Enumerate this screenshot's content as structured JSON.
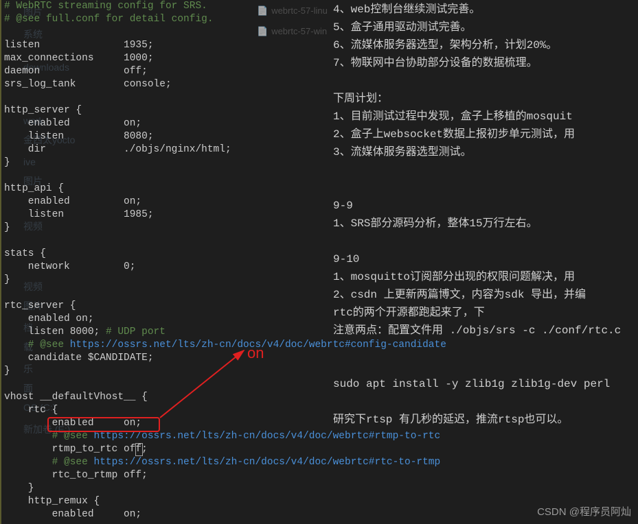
{
  "code": {
    "l1": "# WebRTC streaming config for SRS.",
    "l2": "# @see full.conf for detail config.",
    "l3": "",
    "l4": "listen              1935;",
    "l5": "max_connections     1000;",
    "l6": "daemon              off;",
    "l7": "srs_log_tank        console;",
    "l8": "",
    "l9": "http_server {",
    "l10": "    enabled         on;",
    "l11": "    listen          8080;",
    "l12": "    dir             ./objs/nginx/html;",
    "l13": "}",
    "l14": "",
    "l15": "http_api {",
    "l16": "    enabled         on;",
    "l17": "    listen          1985;",
    "l18": "}",
    "l19": "",
    "l20": "stats {",
    "l21": "    network         0;",
    "l22": "}",
    "l23": "",
    "l24": "rtc_server {",
    "l25": "    enabled on;",
    "l26a": "    listen 8000; ",
    "l26b": "# UDP port",
    "l27a": "    # @see ",
    "l27b": "https://ossrs.net/lts/zh-cn/docs/v4/doc/webrtc#config-candidate",
    "l28": "    candidate $CANDIDATE;",
    "l29": "}",
    "l30": "",
    "l31": "vhost __defaultVhost__ {",
    "l32": "    rtc {",
    "l33": "        enabled     on;",
    "l34a": "        # @see ",
    "l34b": "https://ossrs.net/lts/zh-cn/docs/v4/doc/webrtc#rtmp-to-rtc",
    "l35a": "        rtmp_to_rtc of",
    "l35b": "f",
    "l35c": ";",
    "l36a": "        # @see ",
    "l36b": "https://ossrs.net/lts/zh-cn/docs/v4/doc/webrtc#rtc-to-rtmp",
    "l37": "        rtc_to_rtmp off;",
    "l38": "    }",
    "l39": "    http_remux {",
    "l40": "        enabled     on;"
  },
  "annotation": {
    "label": "on"
  },
  "tabs": {
    "t1": "webrtc-57-linu",
    "t2": "webrtc-57-win"
  },
  "tree": {
    "i1": "图片",
    "i2": "系统",
    "i3": "",
    "i4": "",
    "i5": "downloads",
    "i6": "",
    "i7": "",
    "i8": "",
    "i9": "work",
    "i10": "金西太yocto",
    "i11": "ive",
    "i12": "图片",
    "i13": "",
    "i14": "视频",
    "i15": "",
    "i16": "视频",
    "i17": "图片",
    "i18": "",
    "i19": "档",
    "i20": "载",
    "i21": "乐",
    "i22": "面",
    "i23": "OS (C:)",
    "i24": "新加卷 (E:)"
  },
  "notes": {
    "n1": "4、web控制台继续测试完善。",
    "n2": "5、盒子通用驱动测试完善。",
    "n3": "6、流媒体服务器选型，架构分析，计划20%。",
    "n4": "7、物联网中台协助部分设备的数据梳理。",
    "n5": "下周计划：",
    "n6": "1、目前测试过程中发现，盒子上移植的mosquit",
    "n7": "2、盒子上websocket数据上报初步单元测试，用",
    "n8": "3、流媒体服务器选型测试。",
    "n9": "9-9",
    "n10": "1、SRS部分源码分析，整体15万行左右。",
    "n11": "9-10",
    "n12": "1、mosquitto订阅部分出现的权限问题解决，用",
    "n13": "2、csdn 上更新两篇博文，内容为sdk 导出，并编",
    "n14": "                                      rtc的两个开源都跑起来了，下",
    "n15": "注意两点：配置文件用 ./objs/srs -c ./conf/rtc.c",
    "n16": "sudo apt install -y zlib1g zlib1g-dev perl",
    "n17": "研究下rtsp 有几秒的延迟，推流rtsp也可以。"
  },
  "watermark": "CSDN @程序员阿灿"
}
